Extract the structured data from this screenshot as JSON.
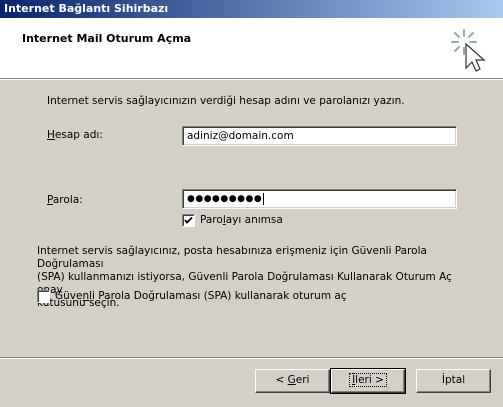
{
  "window": {
    "title": "Internet Bağlantı Sihirbazı"
  },
  "header": {
    "title": "Internet Mail Oturum Açma",
    "icon": "wizard-wand-cursor-icon"
  },
  "instructions": "Internet servis sağlayıcınızın verdiği hesap adını ve parolanızı yazın.",
  "account": {
    "label_accel": "H",
    "label_rest": "esap adı:",
    "value": "adiniz@domain.com"
  },
  "password": {
    "label_accel": "P",
    "label_rest": "arola:",
    "value": "●●●●●●●●●"
  },
  "remember": {
    "label_pre": "Paro",
    "label_accel": "l",
    "label_post": "ayı anımsa",
    "checked": true
  },
  "spa_info": {
    "line1": "Internet servis sağlayıcınız, posta hesabınıza erişmeniz için Güvenli Parola Doğrulaması",
    "line2": "(SPA) kullanmanızı istiyorsa, Güvenli Parola Doğrulaması Kullanarak Oturum Aç onay",
    "line3": "kutusunu seçin."
  },
  "spa_checkbox": {
    "label_pre": "Güve",
    "label_accel": "n",
    "label_post": "li Parola Doğrulaması (SPA) kullanarak oturum aç",
    "checked": false
  },
  "buttons": {
    "back_prefix": "< ",
    "back_accel": "G",
    "back_rest": "eri",
    "next_accel": "İ",
    "next_rest": "leri >",
    "cancel": "İptal"
  }
}
